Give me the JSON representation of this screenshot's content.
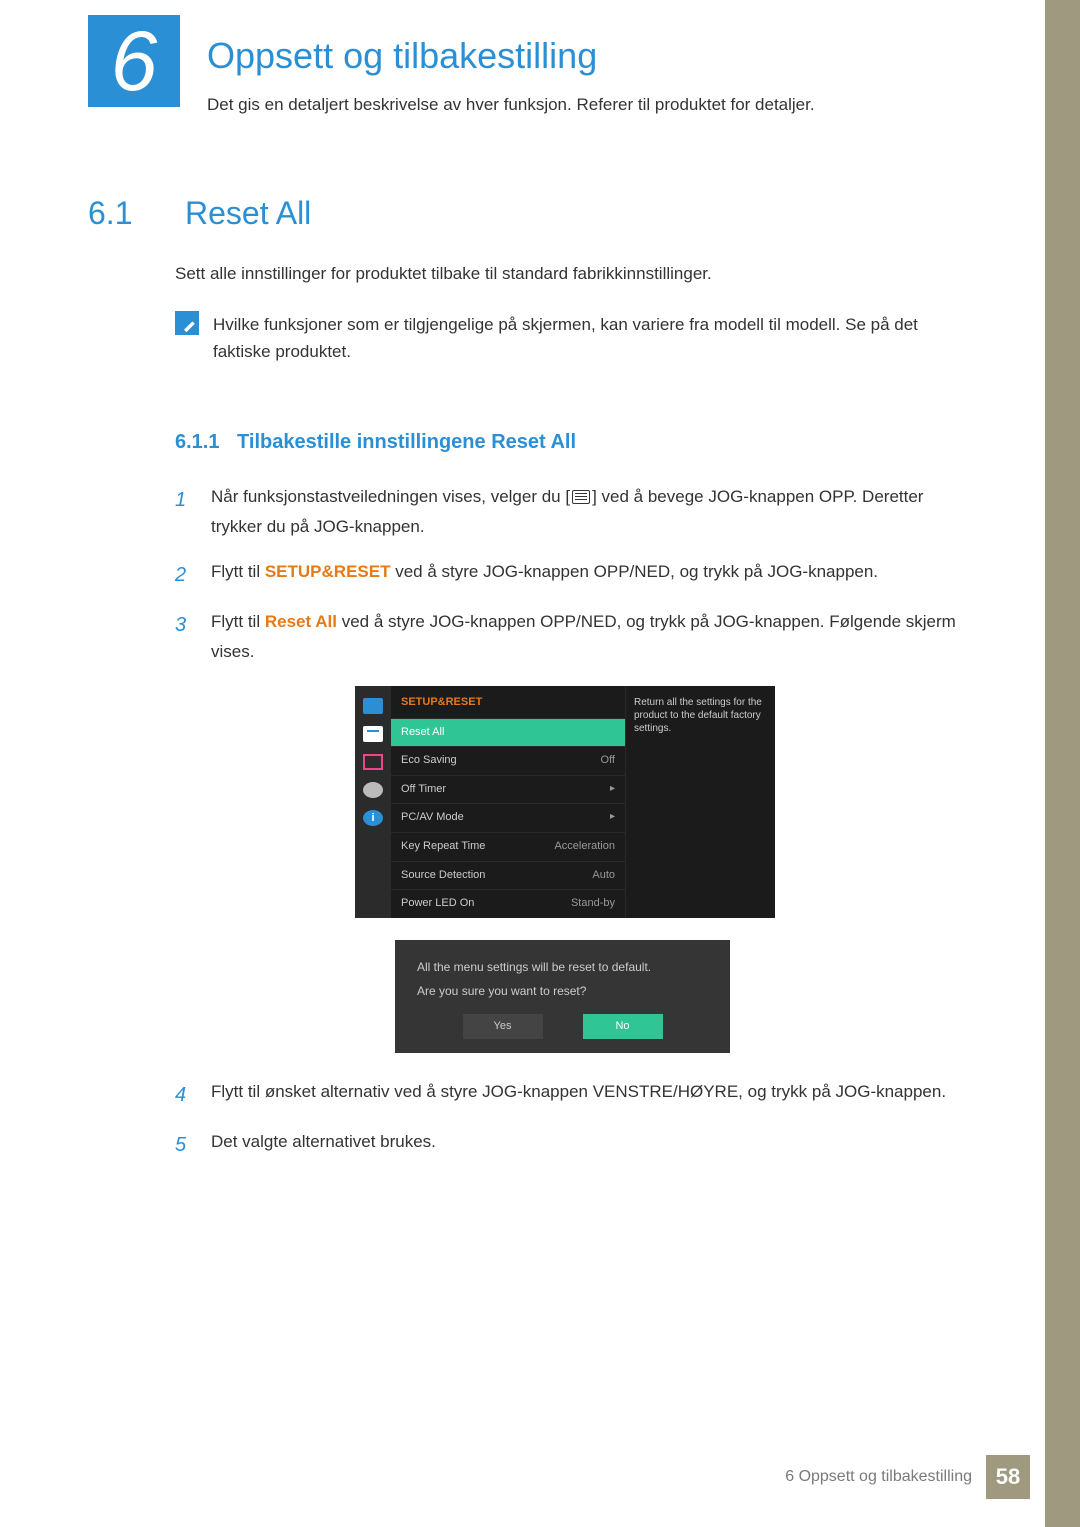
{
  "chapter": {
    "number": "6",
    "title": "Oppsett og tilbakestilling",
    "subtitle": "Det gis en detaljert beskrivelse av hver funksjon. Referer til produktet for detaljer."
  },
  "sections": {
    "s61": {
      "num": "6.1",
      "title": "Reset All",
      "intro": "Sett alle innstillinger for produktet tilbake til standard fabrikkinnstillinger.",
      "note": "Hvilke funksjoner som er tilgjengelige på skjermen, kan variere fra modell til modell. Se på det faktiske produktet."
    },
    "s611": {
      "num": "6.1.1",
      "title": "Tilbakestille innstillingene Reset All",
      "steps": {
        "s1a": "Når funksjonstastveiledningen vises, velger du [",
        "s1b": "] ved å bevege JOG-knappen OPP. Deretter trykker du på JOG-knappen.",
        "s2a": "Flytt til ",
        "s2b": "SETUP&RESET",
        "s2c": " ved å styre JOG-knappen OPP/NED, og trykk på JOG-knappen.",
        "s3a": "Flytt til ",
        "s3b": "Reset All",
        "s3c": " ved å styre JOG-knappen OPP/NED, og trykk på JOG-knappen. Følgende skjerm vises.",
        "s4": "Flytt til ønsket alternativ ved å styre JOG-knappen VENSTRE/HØYRE, og trykk på JOG-knappen.",
        "s5": "Det valgte alternativet brukes."
      }
    }
  },
  "osd": {
    "header": "SETUP&RESET",
    "help": "Return all the settings for the product to the default factory settings.",
    "items": [
      {
        "label": "Reset All",
        "value": "",
        "sel": true
      },
      {
        "label": "Eco Saving",
        "value": "Off"
      },
      {
        "label": "Off Timer",
        "value": "▸"
      },
      {
        "label": "PC/AV Mode",
        "value": "▸"
      },
      {
        "label": "Key Repeat Time",
        "value": "Acceleration"
      },
      {
        "label": "Source Detection",
        "value": "Auto"
      },
      {
        "label": "Power LED On",
        "value": "Stand-by"
      }
    ],
    "dialog": {
      "line1": "All the menu settings will be reset to default.",
      "line2": "Are you sure you want to reset?",
      "yes": "Yes",
      "no": "No"
    }
  },
  "footer": {
    "text": "6 Oppsett og tilbakestilling",
    "page": "58"
  }
}
